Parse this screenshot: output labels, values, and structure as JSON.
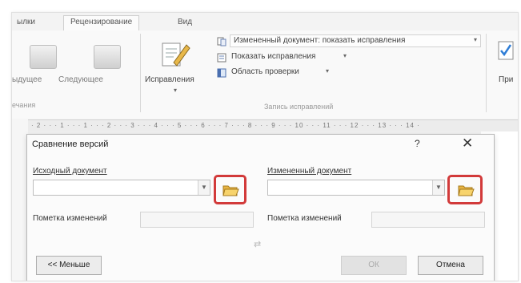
{
  "ribbon": {
    "tabs": [
      {
        "label": "ылки",
        "active": false
      },
      {
        "label": "Рецензирование",
        "active": true
      },
      {
        "label": "Вид",
        "active": false
      }
    ],
    "prev_label": "ыдущее",
    "next_label": "Следующее",
    "left_group_label": "ечания",
    "track_label": "Исправления",
    "display_for_review": "Измененный документ: показать исправления",
    "show_markup": "Показать исправления",
    "reviewing_pane": "Область проверки",
    "group_label": "Запись исправлений",
    "right_cut_label": "При"
  },
  "ruler": {
    "text": "· 2 · · · 1 · · · 1 · · · 2 · · · 3 · · · 4 · · · 5 · · · 6 · · · 7 · · · 8 · · · 9 · · · 10 · · · 11 · · · 12 · · · 13 · · · 14 ·"
  },
  "dialog": {
    "title": "Сравнение версий",
    "help": "?",
    "close": "✕",
    "original_label": "Исходный документ",
    "original_value": "",
    "original_mark_label": "Пометка изменений",
    "original_mark_value": "",
    "revised_label": "Измененный документ",
    "revised_value": "",
    "revised_mark_label": "Пометка изменений",
    "revised_mark_value": "",
    "swap_icon": "⇄",
    "less_button": "<< Меньше",
    "ok_button": "ОК",
    "cancel_button": "Отмена"
  },
  "colors": {
    "highlight": "#d23a3a",
    "folder": "#f2c94c"
  }
}
